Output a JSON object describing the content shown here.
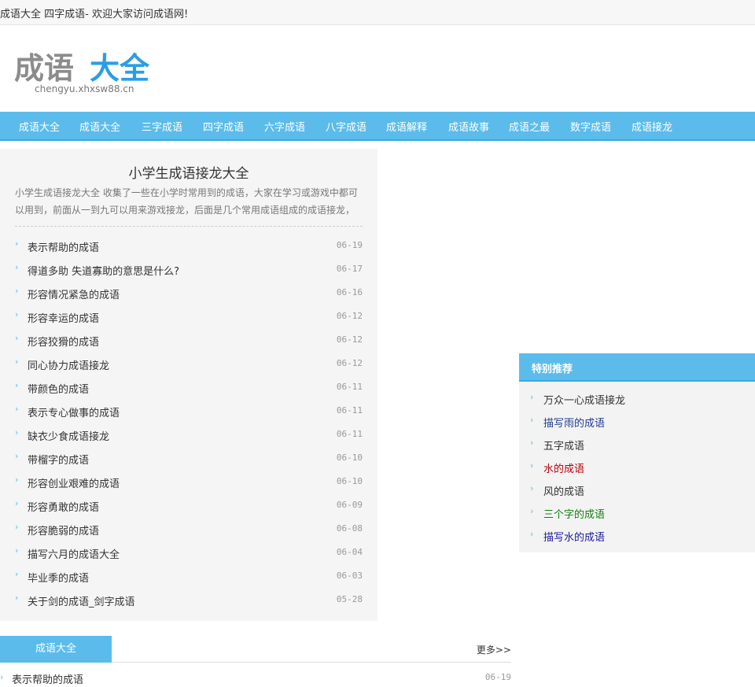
{
  "topbar": {
    "welcome": "成语大全  四字成语- 欢迎大家访问成语网!"
  },
  "logo": {
    "main_gray": "成语",
    "main_blue": "大全",
    "domain": "chengyu.xhxsw88.cn"
  },
  "nav": {
    "items": [
      "成语大全",
      "成语大全",
      "三字成语",
      "四字成语",
      "六字成语",
      "八字成语",
      "成语解释",
      "成语故事",
      "成语之最",
      "数字成语",
      "成语接龙"
    ]
  },
  "main": {
    "title": "小学生成语接龙大全",
    "intro": "小学生成语接龙大全 收集了一些在小学时常用到的成语，大家在学习或游戏中都可以用到，前面从一到九可以用来游戏接龙，后面是几个常用成语组成的成语接龙，",
    "list": [
      {
        "title": "表示帮助的成语",
        "date": "06-19"
      },
      {
        "title": "得道多助 失道寡助的意思是什么?",
        "date": "06-17"
      },
      {
        "title": "形容情况紧急的成语",
        "date": "06-16"
      },
      {
        "title": "形容幸运的成语",
        "date": "06-12"
      },
      {
        "title": "形容狡猾的成语",
        "date": "06-12"
      },
      {
        "title": "同心协力成语接龙",
        "date": "06-12"
      },
      {
        "title": "带颜色的成语",
        "date": "06-11"
      },
      {
        "title": "表示专心做事的成语",
        "date": "06-11"
      },
      {
        "title": "缺衣少食成语接龙",
        "date": "06-11"
      },
      {
        "title": "带榴字的成语",
        "date": "06-10"
      },
      {
        "title": "形容创业艰难的成语",
        "date": "06-10"
      },
      {
        "title": "形容勇敢的成语",
        "date": "06-09"
      },
      {
        "title": "形容脆弱的成语",
        "date": "06-08"
      },
      {
        "title": "描写六月的成语大全",
        "date": "06-04"
      },
      {
        "title": "毕业季的成语",
        "date": "06-03"
      },
      {
        "title": "关于剑的成语_剑字成语",
        "date": "05-28"
      }
    ]
  },
  "side": {
    "title": "特别推荐",
    "items": [
      {
        "title": "万众一心成语接龙",
        "color": "#333333"
      },
      {
        "title": "描写雨的成语",
        "color": "#1f3c8f"
      },
      {
        "title": "五字成语",
        "color": "#333333"
      },
      {
        "title": "水的成语",
        "color": "#b5000a"
      },
      {
        "title": "风的成语",
        "color": "#333333"
      },
      {
        "title": "三个字的成语",
        "color": "#13800f"
      },
      {
        "title": "描写水的成语",
        "color": "#1a1a9c"
      }
    ]
  },
  "section": {
    "tab": "成语大全",
    "more": "更多>>",
    "first_item": {
      "title": "表示帮助的成语",
      "date": "06-19"
    }
  },
  "colors": {
    "accent": "#5bbcec",
    "accent_dark": "#3aa8de",
    "panel": "#f5f5f5"
  }
}
